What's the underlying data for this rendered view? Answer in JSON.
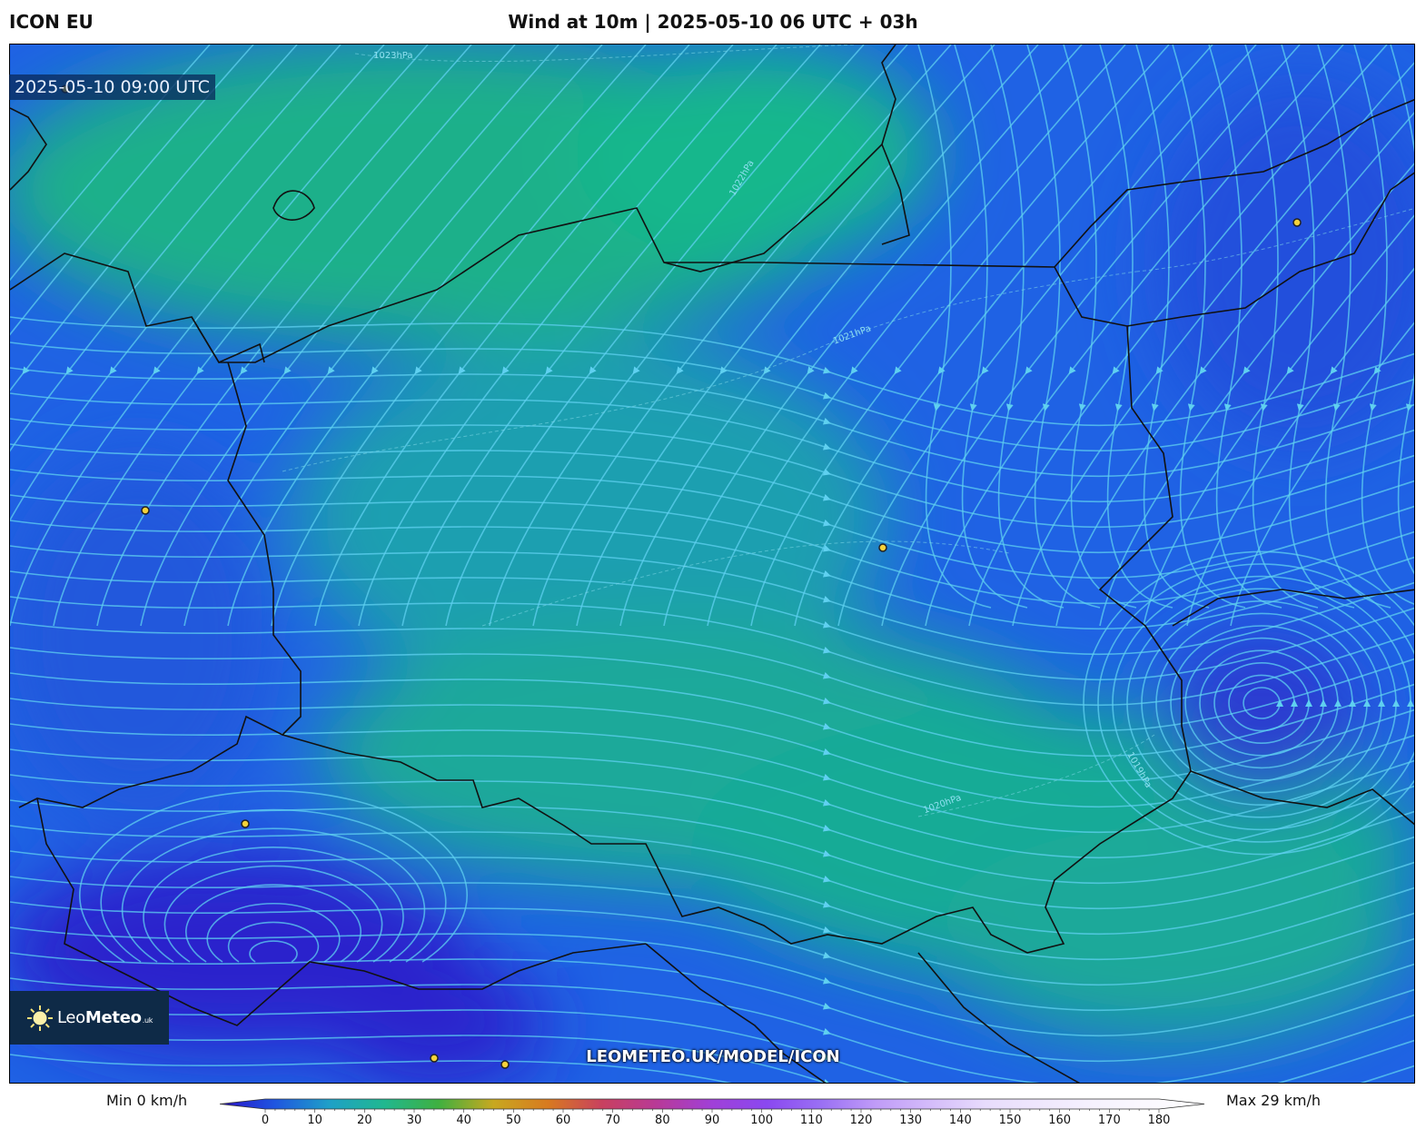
{
  "header": {
    "model": "ICON EU",
    "title": "Wind at 10m | 2025-05-10 06 UTC + 03h"
  },
  "map": {
    "valid_time": "2025-05-10 09:00 UTC",
    "watermark": "LEOMETEO.UK/MODEL/ICON",
    "isobar_labels": [
      "1023hPa",
      "1022hPa",
      "1021hPa",
      "1020hPa",
      "1019hPa"
    ],
    "colors": {
      "calm": "#2a2fd8",
      "light": "#1f6ee6",
      "moderate": "#18b48f",
      "streamline": "#5fd0f0",
      "border": "#111111",
      "city_marker": "#f5d23a"
    }
  },
  "logo": {
    "name_light": "Leo",
    "name_bold": "Meteo",
    "suffix": ".uk"
  },
  "legend": {
    "min_label": "Min 0 km/h",
    "max_label": "Max 29 km/h",
    "unit": "km/h",
    "ticks": [
      "0",
      "10",
      "20",
      "30",
      "40",
      "50",
      "60",
      "70",
      "80",
      "90",
      "100",
      "110",
      "120",
      "130",
      "140",
      "150",
      "160",
      "170",
      "180"
    ],
    "stops": [
      {
        "value": 0,
        "color": "#2a10c8"
      },
      {
        "value": 10,
        "color": "#1f55e0"
      },
      {
        "value": 20,
        "color": "#1fa0c8"
      },
      {
        "value": 30,
        "color": "#20b890"
      },
      {
        "value": 40,
        "color": "#3fb040"
      },
      {
        "value": 50,
        "color": "#c8a820"
      },
      {
        "value": 60,
        "color": "#d87a20"
      },
      {
        "value": 70,
        "color": "#c84060"
      },
      {
        "value": 80,
        "color": "#b83a98"
      },
      {
        "value": 90,
        "color": "#a040d8"
      },
      {
        "value": 100,
        "color": "#8a48f0"
      },
      {
        "value": 110,
        "color": "#9a70f4"
      },
      {
        "value": 120,
        "color": "#c09cf8"
      },
      {
        "value": 140,
        "color": "#e8dcfc"
      },
      {
        "value": 160,
        "color": "#f6f2fe"
      },
      {
        "value": 180,
        "color": "#ffffff"
      }
    ]
  }
}
